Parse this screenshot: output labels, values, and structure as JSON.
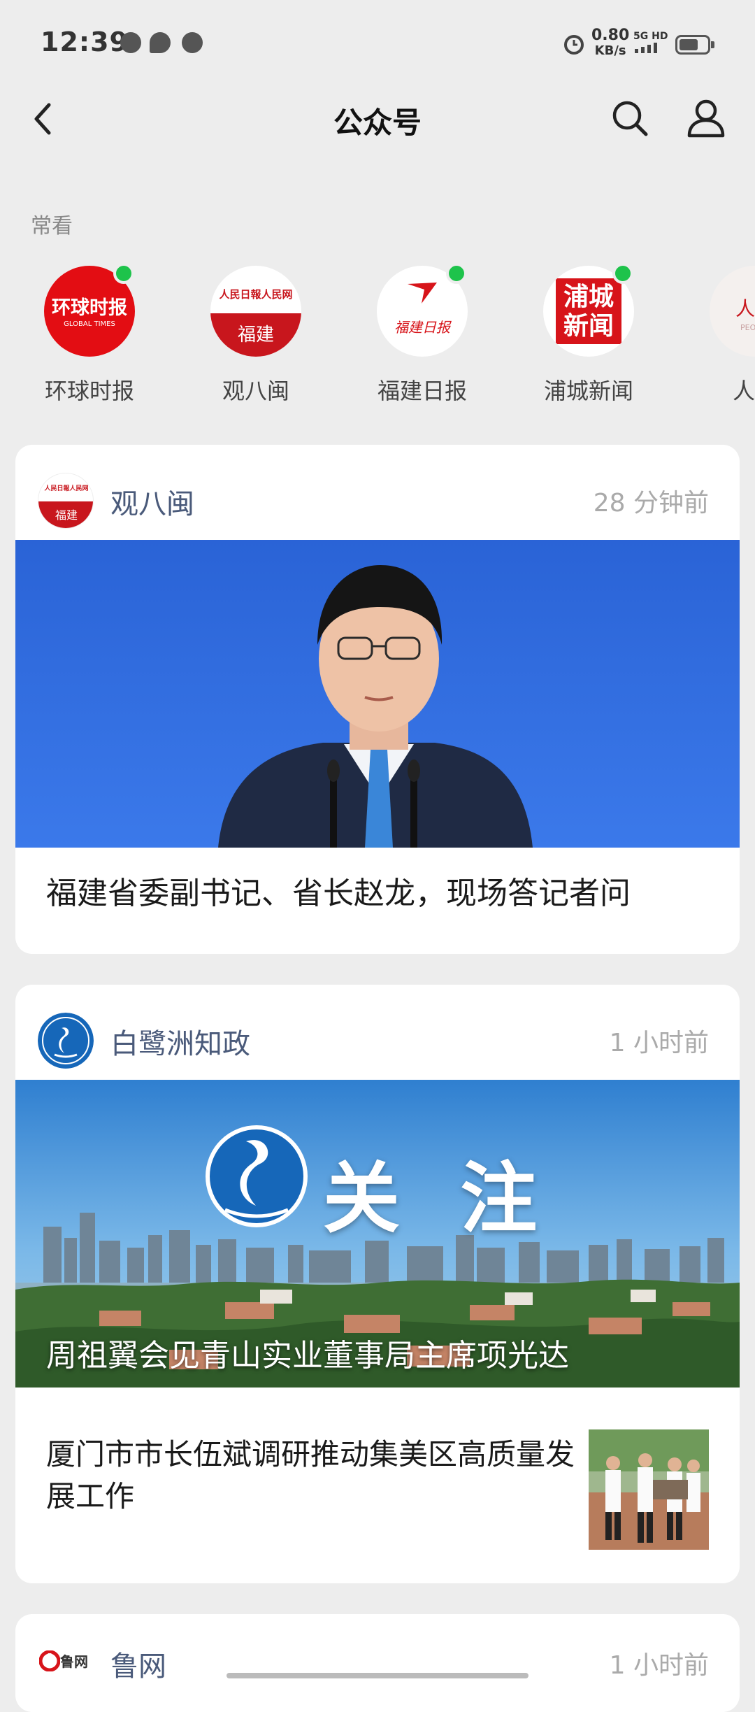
{
  "status_bar": {
    "time": "12:39",
    "speed_value": "0.80",
    "speed_unit": "KB/s",
    "network": "5G HD"
  },
  "nav": {
    "title": "公众号"
  },
  "frequent": {
    "label": "常看",
    "items": [
      {
        "name": "环球时报",
        "logo_text": "环球时报",
        "logo_sub": "GLOBAL TIMES",
        "unread": true
      },
      {
        "name": "观八闽",
        "logo_text": "人民日報人民网",
        "logo_sub": "福建",
        "unread": false
      },
      {
        "name": "福建日报",
        "logo_text": "福建日报",
        "unread": true
      },
      {
        "name": "浦城新闻",
        "logo_text": "浦城新闻",
        "unread": true
      },
      {
        "name": "人民",
        "logo_text": "人民",
        "logo_sub": "PEOPLE",
        "unread": false
      }
    ]
  },
  "cards": [
    {
      "account": "观八闽",
      "time": "28 分钟前",
      "logo_text": "人民日報人民网",
      "logo_sub": "福建",
      "headline": "福建省委副书记、省长赵龙，现场答记者问"
    },
    {
      "account": "白鹭洲知政",
      "time": "1 小时前",
      "banner_text": "关 注",
      "banner_caption": "周祖翼会见青山实业董事局主席项光达",
      "secondary_headline": "厦门市市长伍斌调研推动集美区高质量发展工作"
    },
    {
      "account": "鲁网",
      "logo_text": "鲁网",
      "time": "1 小时前"
    }
  ],
  "colors": {
    "accent_red": "#d7141a",
    "unread_dot": "#1ec34b",
    "account_name": "#4a5a7a"
  }
}
